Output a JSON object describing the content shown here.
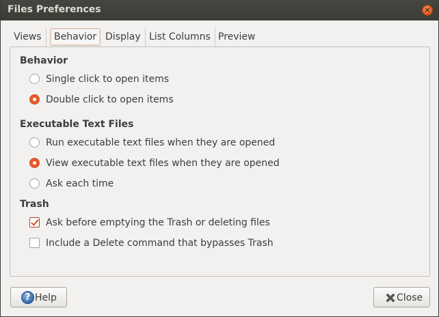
{
  "window": {
    "title": "Files Preferences"
  },
  "tabs": [
    {
      "label": "Views"
    },
    {
      "label": "Behavior",
      "active": true
    },
    {
      "label": "Display"
    },
    {
      "label": "List Columns"
    },
    {
      "label": "Preview"
    }
  ],
  "behavior": {
    "heading": "Behavior",
    "options": [
      {
        "label": "Single click to open items",
        "selected": false
      },
      {
        "label": "Double click to open items",
        "selected": true
      }
    ]
  },
  "executable": {
    "heading": "Executable Text Files",
    "options": [
      {
        "label": "Run executable text files when they are opened",
        "selected": false
      },
      {
        "label": "View executable text files when they are opened",
        "selected": true
      },
      {
        "label": "Ask each time",
        "selected": false
      }
    ]
  },
  "trash": {
    "heading": "Trash",
    "options": [
      {
        "label": "Ask before emptying the Trash or deleting files",
        "checked": true
      },
      {
        "label": "Include a Delete command that bypasses Trash",
        "checked": false
      }
    ]
  },
  "buttons": {
    "help": "Help",
    "close": "Close"
  },
  "icons": {
    "help": "help-icon",
    "close": "close-icon",
    "window_close": "window-close-icon"
  },
  "colors": {
    "accent": "#e9592a",
    "titlebar": "#3c3b37",
    "help_blue": "#3569a8"
  }
}
